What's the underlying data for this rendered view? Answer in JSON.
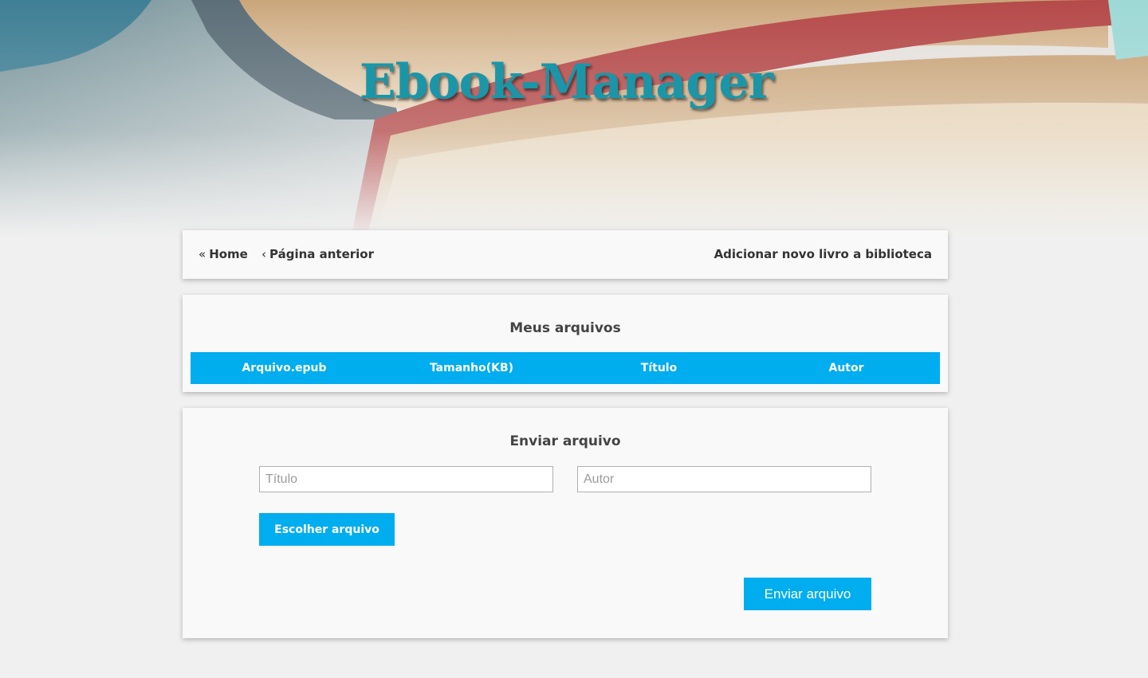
{
  "header": {
    "site_title": "Ebook-Manager"
  },
  "nav": {
    "home": {
      "chevron": "«",
      "label": "Home"
    },
    "previous": {
      "chevron": "‹",
      "label": "Página anterior"
    },
    "add_book": "Adicionar novo livro a biblioteca"
  },
  "files": {
    "title": "Meus arquivos",
    "columns": [
      "Arquivo.epub",
      "Tamanho(KB)",
      "Título",
      "Autor"
    ],
    "rows": []
  },
  "upload": {
    "title": "Enviar arquivo",
    "title_field": {
      "placeholder": "Título",
      "value": ""
    },
    "author_field": {
      "placeholder": "Autor",
      "value": ""
    },
    "choose_file_label": "Escolher arquivo",
    "submit_label": "Enviar arquivo"
  },
  "colors": {
    "accent": "#00adef",
    "title": "#1b96a8",
    "page_background": "#f0f0f0",
    "card_background": "#f9f9f9"
  }
}
